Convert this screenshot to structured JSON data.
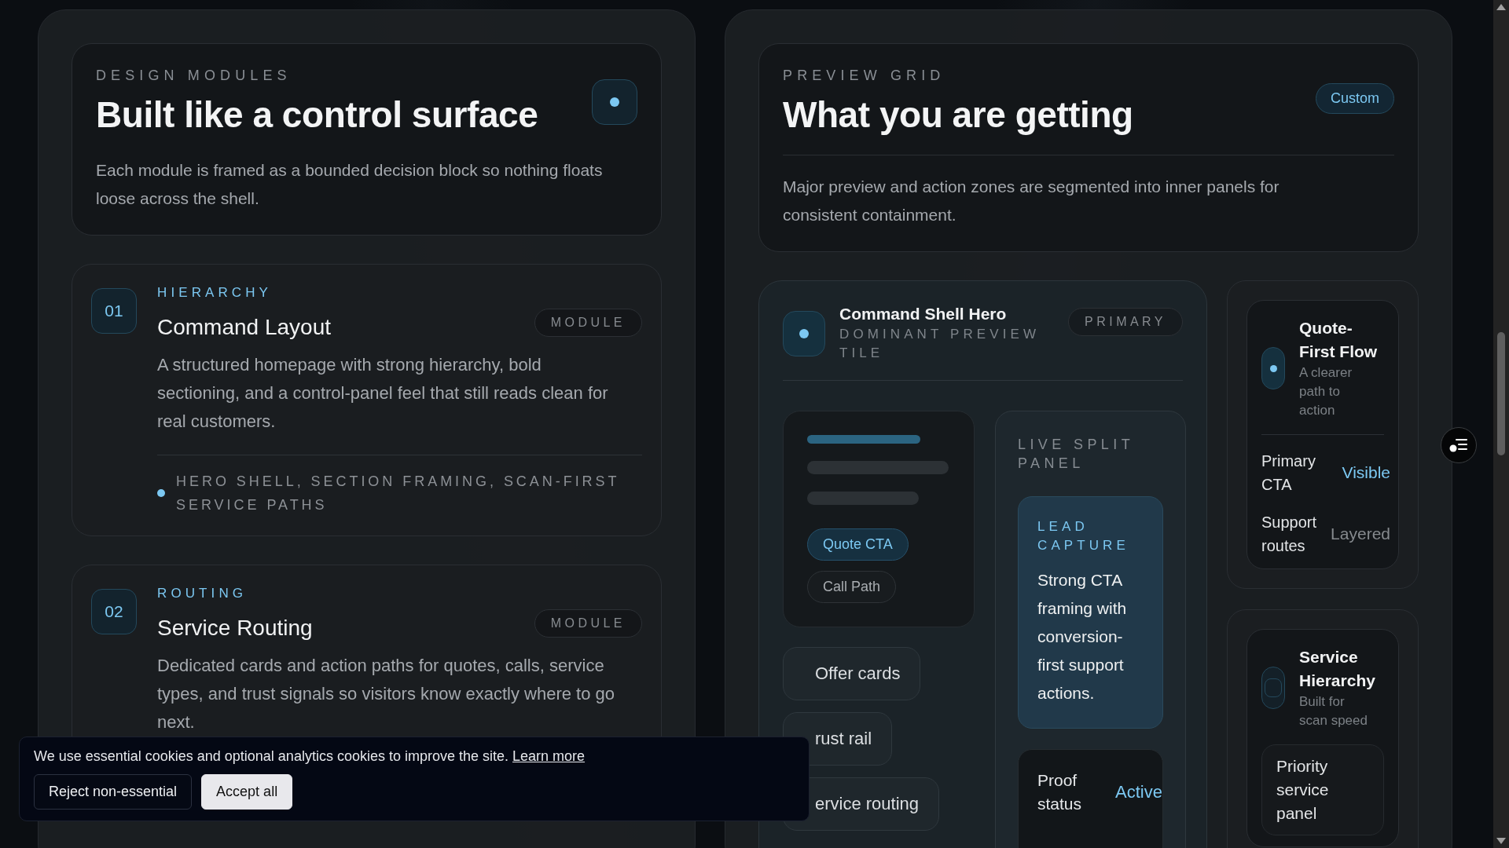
{
  "left": {
    "header": {
      "eyebrow": "DESIGN MODULES",
      "title": "Built like a control surface",
      "description": "Each module is framed as a bounded decision block so nothing floats loose across the shell."
    },
    "modules": [
      {
        "number": "01",
        "tag": "HIERARCHY",
        "title": "Command Layout",
        "badge": "MODULE",
        "description": "A structured homepage with strong hierarchy, bold sectioning, and a control-panel feel that still reads clean for real customers.",
        "bullet": "HERO SHELL, SECTION FRAMING, SCAN-FIRST SERVICE PATHS"
      },
      {
        "number": "02",
        "tag": "ROUTING",
        "title": "Service Routing",
        "badge": "MODULE",
        "description": "Dedicated cards and action paths for quotes, calls, service types, and trust signals so visitors know exactly where to go next."
      }
    ]
  },
  "right": {
    "header": {
      "eyebrow": "PREVIEW GRID",
      "title": "What you are getting",
      "badge": "Custom",
      "description": "Major preview and action zones are segmented into inner panels for consistent containment."
    },
    "hero": {
      "title": "Command Shell Hero",
      "subtitle": "DOMINANT PREVIEW TILE",
      "badge": "PRIMARY",
      "chips": [
        {
          "label": "Quote CTA",
          "selected": true
        },
        {
          "label": "Call Path",
          "selected": false
        }
      ],
      "actions": [
        "Offer cards",
        "rust rail",
        "ervice routing"
      ],
      "live_panel": {
        "eyebrow": "LIVE SPLIT PANEL",
        "lead": {
          "eyebrow": "LEAD CAPTURE",
          "text": "Strong CTA framing with conversion-first support actions."
        },
        "status": {
          "label": "Proof status",
          "value": "Active"
        }
      }
    },
    "side_cards": [
      {
        "title": "Quote-First Flow",
        "subtitle": "A clearer path to action",
        "active": true,
        "rows": [
          {
            "label": "Primary CTA",
            "value": "Visible",
            "highlighted": true
          },
          {
            "label": "Support routes",
            "value": "Layered",
            "highlighted": false
          }
        ]
      },
      {
        "title": "Service Hierarchy",
        "subtitle": "Built for scan speed",
        "active": false,
        "panel": "Priority service panel"
      }
    ]
  },
  "cookie_banner": {
    "text": "We use essential cookies and optional analytics cookies to improve the site.",
    "link": "Learn more",
    "buttons": [
      {
        "label": "Reject non-essential",
        "kind": "secondary"
      },
      {
        "label": "Accept all",
        "kind": "primary"
      }
    ]
  }
}
